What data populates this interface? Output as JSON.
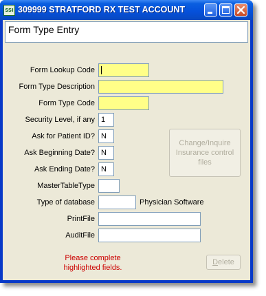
{
  "window": {
    "title": "309999 STRATFORD RX TEST ACCOUNT",
    "icon_text": "SSI",
    "controls": [
      "minimize",
      "maximize",
      "close"
    ]
  },
  "header": {
    "title": "Form Type Entry"
  },
  "form": {
    "lookup_code": {
      "label": "Form Lookup Code",
      "value": ""
    },
    "description": {
      "label": "Form Type Description",
      "value": ""
    },
    "type_code": {
      "label": "Form Type Code",
      "value": ""
    },
    "security": {
      "label": "Security Level, if any",
      "value": "1"
    },
    "patient_id": {
      "label": "Ask for Patient ID?",
      "value": "N"
    },
    "begin_date": {
      "label": "Ask Beginning Date?",
      "value": "N"
    },
    "end_date": {
      "label": "Ask Ending Date?",
      "value": "N"
    },
    "master_table": {
      "label": "MasterTableType",
      "value": ""
    },
    "db_type": {
      "label": "Type of database",
      "value": "",
      "note": "Physician Software"
    },
    "print_file": {
      "label": "PrintFile",
      "value": ""
    },
    "audit_file": {
      "label": "AuditFile",
      "value": ""
    }
  },
  "buttons": {
    "change_inquire": [
      "Change/Inquire",
      "Insurance control",
      "files"
    ],
    "delete": {
      "underlined": "D",
      "rest": "elete"
    }
  },
  "message": [
    "Please complete",
    "highlighted fields."
  ],
  "colors": {
    "required_field": "#ffff88",
    "error_text": "#cc0000",
    "title_bar": "#0551db"
  }
}
